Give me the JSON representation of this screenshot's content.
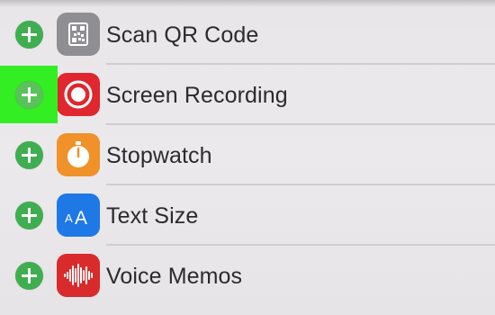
{
  "controls_list": {
    "items": [
      {
        "label": "Scan QR Code",
        "icon": "qr-code-icon",
        "icon_color": "#8e8e93"
      },
      {
        "label": "Screen Recording",
        "icon": "record-icon",
        "icon_color": "#e0262e"
      },
      {
        "label": "Stopwatch",
        "icon": "stopwatch-icon",
        "icon_color": "#f0912a"
      },
      {
        "label": "Text Size",
        "icon": "text-size-icon",
        "icon_color": "#1e78e6"
      },
      {
        "label": "Voice Memos",
        "icon": "waveform-icon",
        "icon_color": "#d92b2b"
      }
    ],
    "add_icon": "plus-circle-icon",
    "add_color": "#3fae50",
    "highlight_color": "#33ee22",
    "text_size_glyph_small": "A",
    "text_size_glyph_large": "A"
  }
}
